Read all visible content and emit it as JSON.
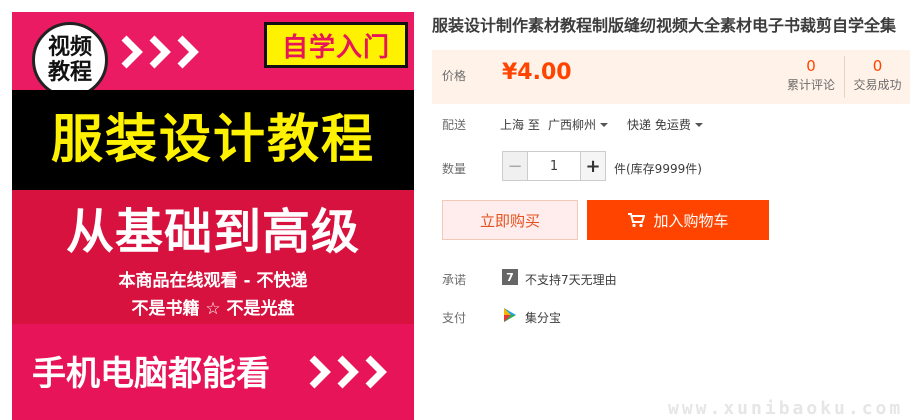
{
  "product_image": {
    "badge_line1": "视频",
    "badge_line2": "教程",
    "self_study": "自学入门",
    "main_title": "服装设计教程",
    "sub_title": "从基础到高级",
    "note_1": "本商品在线观看 - 不快递",
    "note_2": "不是书籍 ☆ 不是光盘",
    "bottom_text": "手机电脑都能看",
    "colors": {
      "pink": "#e8145a",
      "yellow": "#fff200",
      "red": "#d8123f",
      "black": "#000000"
    }
  },
  "product": {
    "title": "服装设计制作素材教程制版缝纫视频大全素材电子书裁剪自学全集"
  },
  "price": {
    "label": "价格",
    "value": "¥4.00",
    "reviews_count": "0",
    "reviews_label": "累计评论",
    "deals_count": "0",
    "deals_label": "交易成功"
  },
  "shipping": {
    "label": "配送",
    "from": "上海 至",
    "destination": "广西柳州",
    "express": "快递 免运费"
  },
  "quantity": {
    "label": "数量",
    "minus": "−",
    "value": "1",
    "plus": "+",
    "stock": "件(库存9999件)"
  },
  "actions": {
    "buy_now": "立即购买",
    "add_to_cart": "加入购物车"
  },
  "promise": {
    "label": "承诺",
    "icon_char": "7",
    "text": "不支持7天无理由"
  },
  "payment": {
    "label": "支付",
    "text": "集分宝"
  },
  "watermark": "www.xunibaoku.com",
  "accent_color": "#ff4400"
}
